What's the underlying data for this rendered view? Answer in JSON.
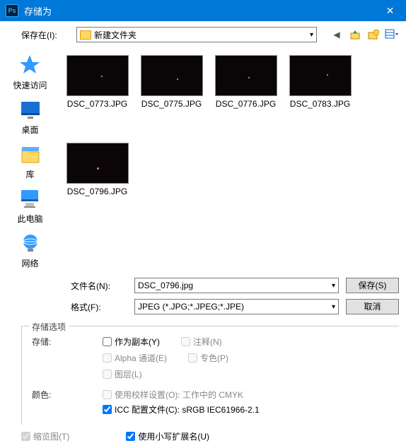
{
  "title": "存储为",
  "toolbar": {
    "lookin_label": "保存在(I):",
    "location": "新建文件夹"
  },
  "sidebar": {
    "items": [
      {
        "label": "快速访问"
      },
      {
        "label": "桌面"
      },
      {
        "label": "库"
      },
      {
        "label": "此电脑"
      },
      {
        "label": "网络"
      }
    ]
  },
  "files": [
    {
      "name": "DSC_0773.JPG"
    },
    {
      "name": "DSC_0775.JPG"
    },
    {
      "name": "DSC_0776.JPG"
    },
    {
      "name": "DSC_0783.JPG"
    },
    {
      "name": "DSC_0796.JPG"
    }
  ],
  "form": {
    "filename_label": "文件名(N):",
    "filename_value": "DSC_0796.jpg",
    "format_label": "格式(F):",
    "format_value": "JPEG (*.JPG;*.JPEG;*.JPE)",
    "save_btn": "保存(S)",
    "cancel_btn": "取消"
  },
  "options": {
    "panel_title": "存储选项",
    "save_label": "存储:",
    "as_copy": "作为副本(Y)",
    "annotations": "注释(N)",
    "alpha": "Alpha 通道(E)",
    "spot": "专色(P)",
    "layers": "图层(L)",
    "color_label": "颜色:",
    "proof": "使用校样设置(O):  工作中的 CMYK",
    "icc": "ICC 配置文件(C):  sRGB IEC61966-2.1",
    "thumbnail": "缩览图(T)",
    "lowercase": "使用小写扩展名(U)"
  }
}
